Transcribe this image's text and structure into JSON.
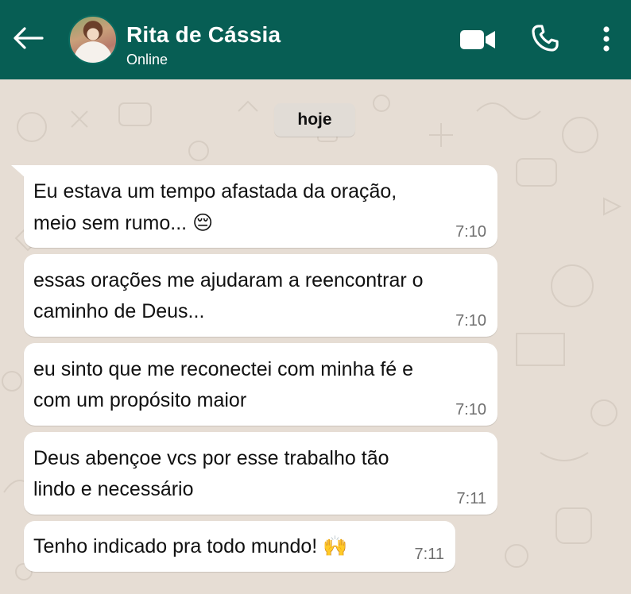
{
  "header": {
    "contact_name": "Rita de Cássia",
    "status": "Online",
    "icons": [
      "back-arrow-icon",
      "avatar",
      "video-call-icon",
      "phone-icon",
      "more-vert-icon"
    ],
    "color": "#075e54"
  },
  "chat": {
    "date_label": "hoje",
    "wallpaper_color": "#e6ddd4",
    "messages": [
      {
        "text": "Eu estava um tempo afastada da oração,\nmeio sem rumo... ",
        "emoji": "😔",
        "time": "7:10"
      },
      {
        "text": "essas orações me ajudaram a reencontrar o\ncaminho de Deus...",
        "emoji": "",
        "time": "7:10"
      },
      {
        "text": "eu sinto que me reconectei com minha fé e\ncom um propósito maior",
        "emoji": "",
        "time": "7:10"
      },
      {
        "text": "Deus abençoe vcs por esse trabalho tão\nlindo e necessário",
        "emoji": "",
        "time": "7:11"
      },
      {
        "text": "Tenho indicado pra todo mundo! ",
        "emoji": "🙌",
        "time": "7:11"
      }
    ]
  }
}
